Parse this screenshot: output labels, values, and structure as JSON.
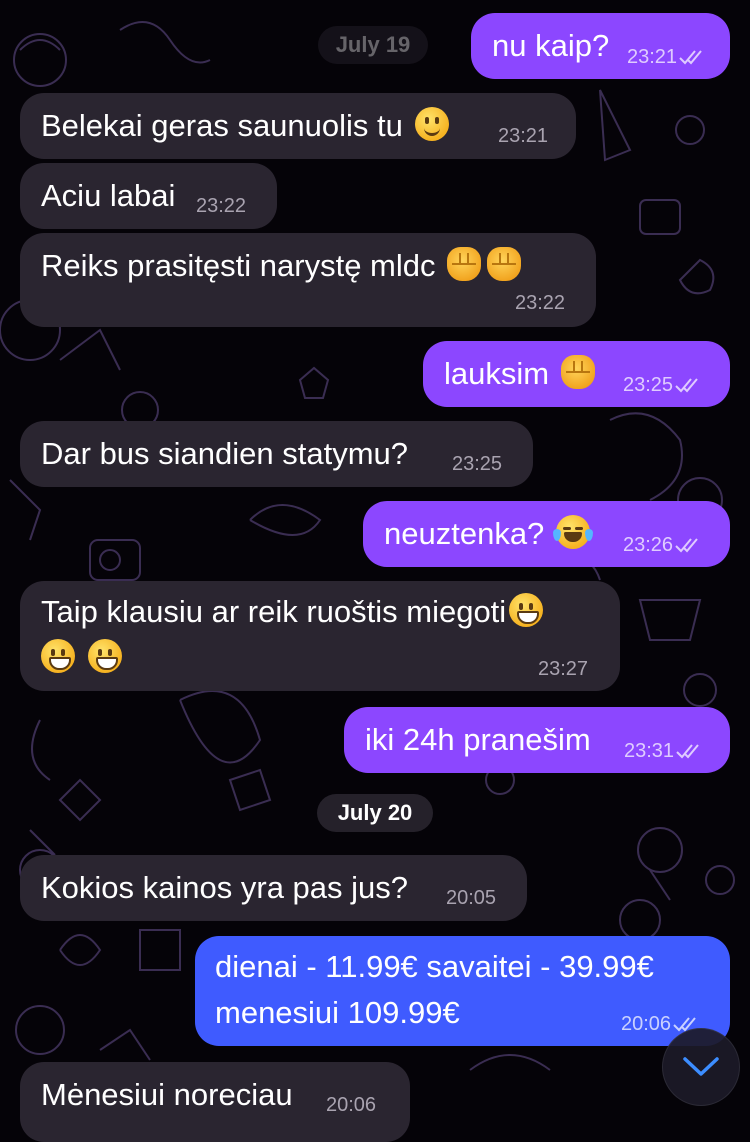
{
  "chat": {
    "date_separators": [
      "July 19",
      "July 20"
    ],
    "messages": [
      {
        "direction": "out",
        "text": "nu kaip?",
        "time": "23:21",
        "status": "read"
      },
      {
        "direction": "in",
        "text": "Belekai geras saunuolis tu",
        "emoji": [
          "slightly-smiling-face"
        ],
        "time": "23:21"
      },
      {
        "direction": "in",
        "text": "Aciu labai",
        "time": "23:22"
      },
      {
        "direction": "in",
        "text": "Reiks prasitęsti narystę mldc",
        "emoji": [
          "oncoming-fist",
          "oncoming-fist"
        ],
        "time": "23:22"
      },
      {
        "direction": "out",
        "text": "lauksim",
        "emoji": [
          "oncoming-fist"
        ],
        "time": "23:25",
        "status": "read"
      },
      {
        "direction": "in",
        "text": "Dar bus siandien statymu?",
        "time": "23:25"
      },
      {
        "direction": "out",
        "text": "neuztenka?",
        "emoji": [
          "face-with-tears-of-joy"
        ],
        "time": "23:26",
        "status": "read"
      },
      {
        "direction": "in",
        "text": "Taip klausiu ar reik ruoštis miegoti",
        "emoji": [
          "grinning-face",
          "grinning-face",
          "grinning-face"
        ],
        "time": "23:27"
      },
      {
        "direction": "out",
        "text": "iki 24h pranešim",
        "time": "23:31",
        "status": "read"
      },
      {
        "direction": "in",
        "text": "Kokios kainos yra pas jus?",
        "time": "20:05"
      },
      {
        "direction": "out",
        "lines": [
          "dienai - 11.99€ savaitei - 39.99€",
          "menesiui 109.99€"
        ],
        "time": "20:06",
        "status": "read"
      },
      {
        "direction": "in",
        "text": "Mėnesiui noreciau",
        "time": "20:06"
      }
    ]
  },
  "icons": {
    "read_receipt": "double-check-icon",
    "scroll_down": "chevron-down-icon"
  },
  "colors": {
    "background": "#050308",
    "incoming_bubble": "#2a2530",
    "outgoing_bubble": "#8c47ff",
    "outgoing_bubble_bottom": "#3f5bff",
    "doodle_stroke": "#3a2d52"
  }
}
